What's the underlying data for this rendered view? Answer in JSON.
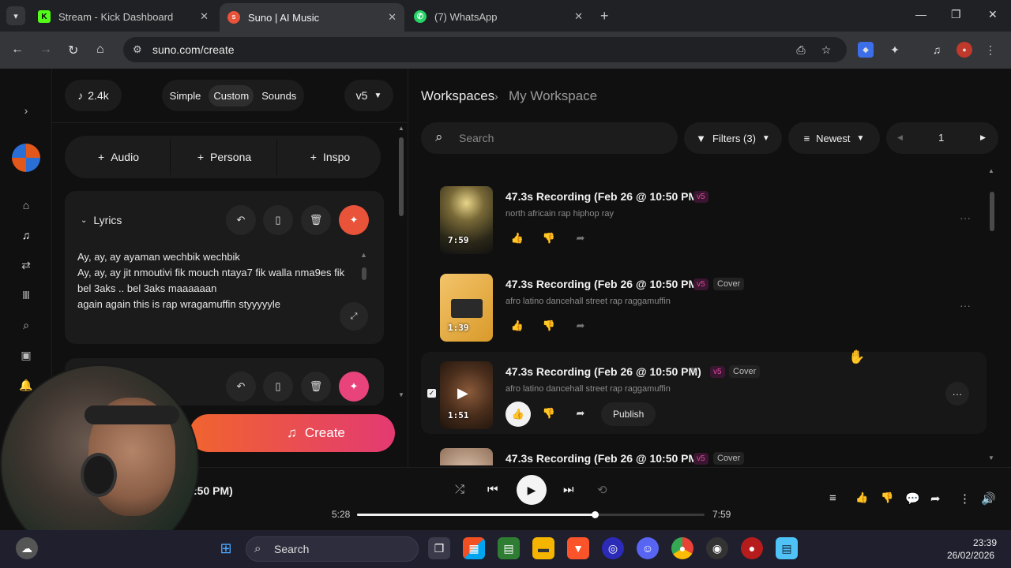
{
  "browser": {
    "tabs": [
      {
        "label": "Stream - Kick Dashboard"
      },
      {
        "label": "Suno | AI Music"
      },
      {
        "label": "(7) WhatsApp"
      }
    ],
    "url": "suno.com/create"
  },
  "left": {
    "credits": "2.4k",
    "modes": [
      "Simple",
      "Custom",
      "Sounds"
    ],
    "model": "v5",
    "add_buttons": [
      "Audio",
      "Persona",
      "Inspo"
    ],
    "lyrics_label": "Lyrics",
    "lyrics_lines": [
      "Ay, ay, ay ayaman wechbik wechbik",
      "Ay, ay, ay jit nmoutivi fik mouch ntaya7 fik walla nma9es fik",
      "bel 3aks .. bel 3aks maaaaaan",
      "again again this is rap wragamuffin   styyyyyle"
    ],
    "create_label": "Create"
  },
  "workspace": {
    "crumb_root": "Workspaces",
    "crumb_current": "My Workspace",
    "search_placeholder": "Search",
    "filters_label": "Filters (3)",
    "sort_label": "Newest",
    "page": "1"
  },
  "songs": [
    {
      "title": "47.3s Recording (Feb 26 @ 10:50 PM)",
      "version": "v5",
      "cover": "",
      "tags": "north africain rap hiphop ray",
      "duration": "7:59"
    },
    {
      "title": "47.3s Recording (Feb 26 @ 10:50 PM)",
      "version": "v5",
      "cover": "Cover",
      "tags": "afro latino dancehall street rap raggamuffin",
      "duration": "1:39"
    },
    {
      "title": "47.3s Recording (Feb 26 @ 10:50 PM)",
      "version": "v5",
      "cover": "Cover",
      "tags": "afro latino dancehall street rap raggamuffin",
      "duration": "1:51",
      "publish": "Publish"
    },
    {
      "title": "47.3s Recording (Feb 26 @ 10:50 PM)",
      "version": "v5",
      "cover": "Cover"
    }
  ],
  "player": {
    "now_playing": "p 26 @ 10:50 PM)",
    "elapsed": "5:28",
    "total": "7:59",
    "progress_fraction": 0.685
  },
  "taskbar": {
    "search_label": "Search",
    "time": "23:39",
    "date": "26/02/2026"
  }
}
